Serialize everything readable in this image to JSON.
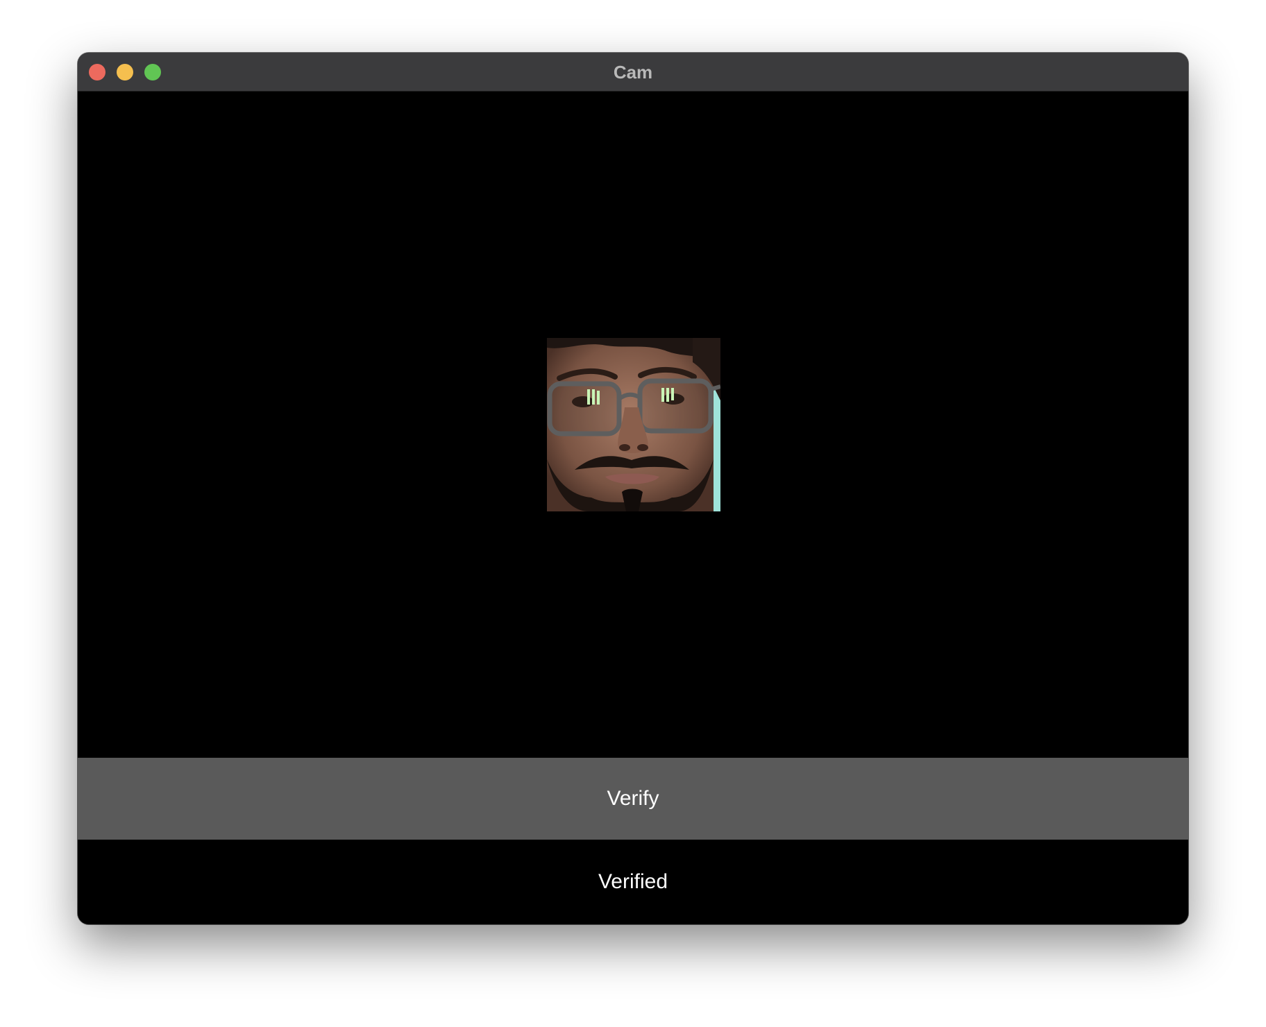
{
  "window": {
    "title": "Cam"
  },
  "camera": {
    "preview_icon": "face-portrait"
  },
  "actions": {
    "verify_label": "Verify"
  },
  "status": {
    "text": "Verified"
  },
  "colors": {
    "titlebar": "#3b3b3d",
    "verify_button": "#5a5a5a",
    "background": "#000000",
    "close": "#ed6a5e",
    "minimize": "#f5bf4f",
    "zoom": "#61c554"
  }
}
